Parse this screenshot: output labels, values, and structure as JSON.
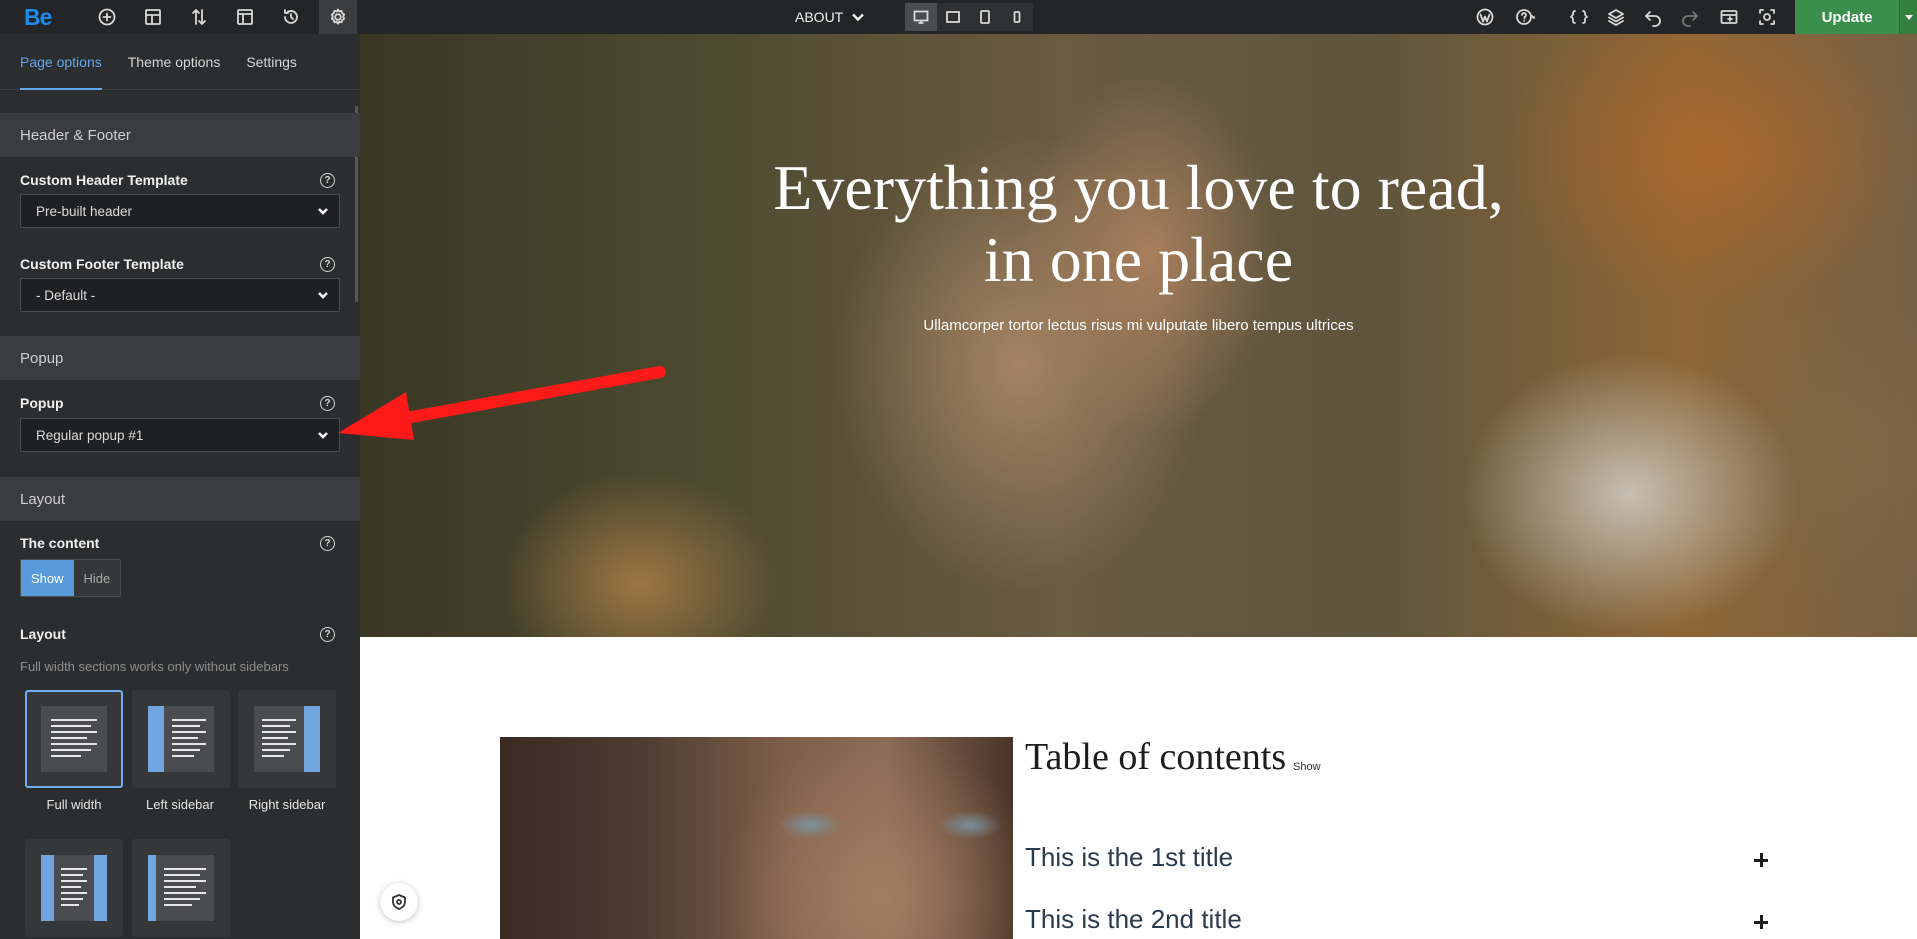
{
  "topbar": {
    "logo": "Be",
    "page_name": "ABOUT",
    "update_label": "Update",
    "left_icons": [
      "add-icon",
      "layout-grid-icon",
      "sort-icon",
      "template-icon",
      "history-icon",
      "settings-icon"
    ],
    "right_icons": [
      "wordpress-icon",
      "help-icon",
      "code-icon",
      "layers-icon",
      "undo-icon",
      "redo-icon",
      "preview-icon",
      "screenshot-icon"
    ],
    "devices": [
      "desktop",
      "laptop",
      "tablet",
      "mobile"
    ]
  },
  "sidebar": {
    "tabs": [
      {
        "label": "Page options",
        "active": true
      },
      {
        "label": "Theme options",
        "active": false
      },
      {
        "label": "Settings",
        "active": false
      }
    ],
    "header_footer": {
      "title": "Header & Footer",
      "header_label": "Custom Header Template",
      "header_value": "Pre-built header",
      "footer_label": "Custom Footer Template",
      "footer_value": "- Default -"
    },
    "popup": {
      "title": "Popup",
      "label": "Popup",
      "value": "Regular popup #1"
    },
    "layout": {
      "title": "Layout",
      "content_label": "The content",
      "show_label": "Show",
      "hide_label": "Hide",
      "layout_label": "Layout",
      "hint": "Full width sections works only without sidebars",
      "options": [
        {
          "label": "Full width",
          "selected": true
        },
        {
          "label": "Left sidebar",
          "selected": false
        },
        {
          "label": "Right sidebar",
          "selected": false
        },
        {
          "label": "",
          "selected": false
        },
        {
          "label": "",
          "selected": false
        }
      ]
    }
  },
  "canvas": {
    "hero_title_line1": "Everything you love to read,",
    "hero_title_line2": "in one place",
    "hero_subtitle": "Ullamcorper tortor lectus risus mi vulputate libero tempus ultrices",
    "toc_title": "Table of contents",
    "toc_toggle": "Show",
    "toc_items": [
      "This is the 1st title",
      "This is the 2nd title"
    ]
  },
  "colors": {
    "accent": "#62a8f0",
    "update": "#3a8f4a",
    "annotation_arrow": "#ff1a1a"
  }
}
